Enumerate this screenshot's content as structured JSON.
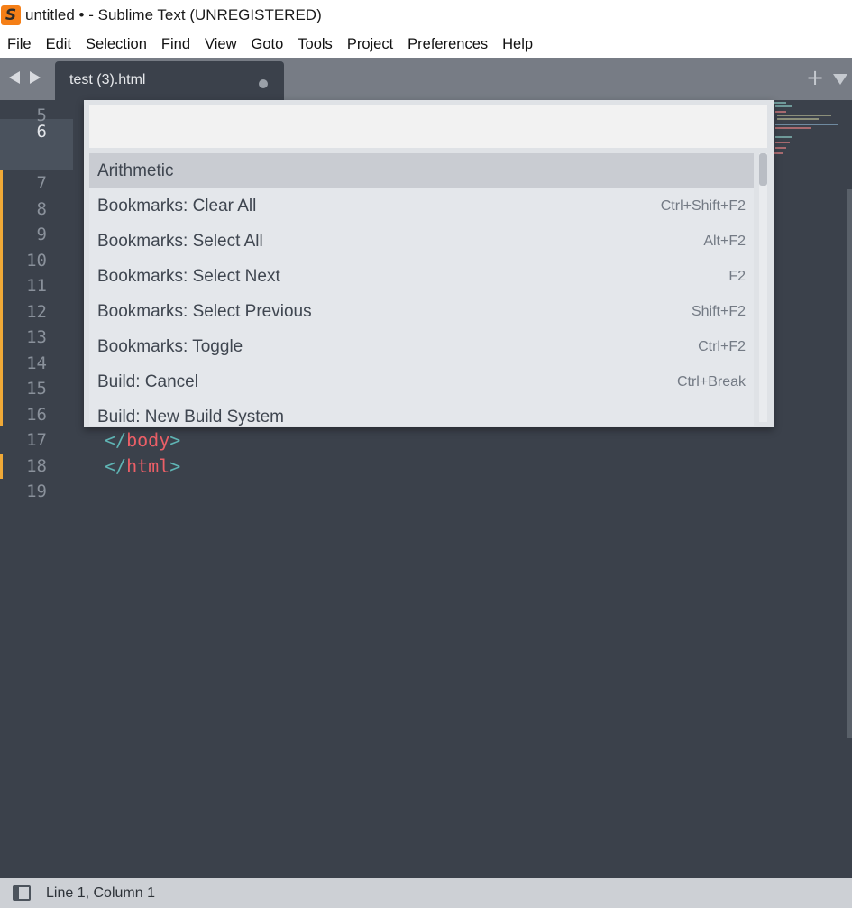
{
  "window": {
    "title": "untitled • - Sublime Text (UNREGISTERED)",
    "logo_glyph": "S"
  },
  "menu": [
    "File",
    "Edit",
    "Selection",
    "Find",
    "View",
    "Goto",
    "Tools",
    "Project",
    "Preferences",
    "Help"
  ],
  "tabs": [
    {
      "label": "test (3).html",
      "modified": true,
      "active": true
    }
  ],
  "tab_actions": {
    "new_tab_glyph": "+"
  },
  "editor": {
    "line_numbers": [
      "5",
      "6",
      "7",
      "8",
      "9",
      "10",
      "11",
      "12",
      "13",
      "14",
      "15",
      "16",
      "17",
      "18",
      "19"
    ],
    "current_line": "6",
    "code_lines": [
      {
        "line": "17",
        "open": "</",
        "tag": "body",
        "close": ">"
      },
      {
        "line": "18",
        "open": "</",
        "tag": "html",
        "close": ">"
      }
    ],
    "colors": {
      "background": "#3b414b",
      "punctuation": "#5fb4b4",
      "tag": "#ec5f67",
      "modified_marker": "#f0a937"
    }
  },
  "command_palette": {
    "query": "",
    "items": [
      {
        "label": "Arithmetic",
        "shortcut": "",
        "selected": true
      },
      {
        "label": "Bookmarks: Clear All",
        "shortcut": "Ctrl+Shift+F2"
      },
      {
        "label": "Bookmarks: Select All",
        "shortcut": "Alt+F2"
      },
      {
        "label": "Bookmarks: Select Next",
        "shortcut": "F2"
      },
      {
        "label": "Bookmarks: Select Previous",
        "shortcut": "Shift+F2"
      },
      {
        "label": "Bookmarks: Toggle",
        "shortcut": "Ctrl+F2"
      },
      {
        "label": "Build: Cancel",
        "shortcut": "Ctrl+Break"
      },
      {
        "label": "Build: New Build System",
        "shortcut": ""
      }
    ]
  },
  "status_bar": {
    "position": "Line 1, Column 1"
  }
}
